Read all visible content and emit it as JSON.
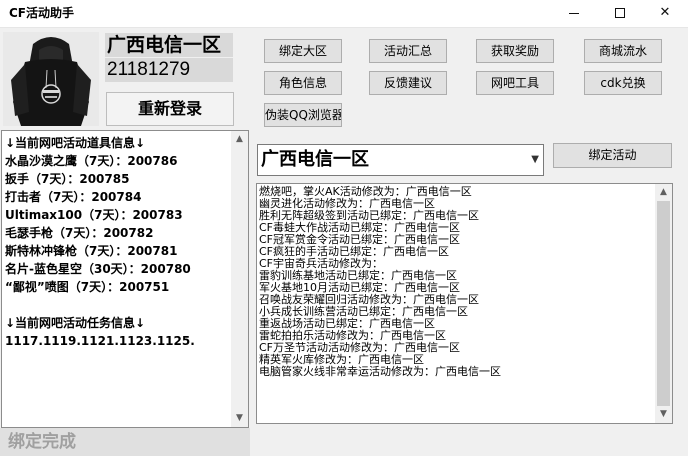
{
  "window": {
    "title": "CF活动助手",
    "controls": {
      "minimize": "—",
      "maximize": "☐",
      "close": "✕"
    }
  },
  "account": {
    "region": "广西电信一区",
    "id": "21181279",
    "relogin_label": "重新登录"
  },
  "toolbar": {
    "row1": [
      "绑定大区",
      "活动汇总",
      "获取奖励",
      "商城流水"
    ],
    "row2": [
      "角色信息",
      "反馈建议",
      "网吧工具",
      "cdk兑换"
    ],
    "row3": [
      "伪装QQ浏览器"
    ]
  },
  "info_panel": {
    "lines": [
      "↓当前网吧活动道具信息↓",
      "水晶沙漠之鹰（7天）：200786",
      "扳手（7天）：200785",
      "打击者（7天）：200784",
      "Ultimax100（7天）：200783",
      "毛瑟手枪（7天）：200782",
      "斯特林冲锋枪（7天）：200781",
      "名片-蓝色星空（30天）：200780",
      "“鄙视”喷图（7天）：200751",
      "",
      "↓当前网吧活动任务信息↓",
      "1117.1119.1121.1123.1125."
    ]
  },
  "status": {
    "text": "绑定完成"
  },
  "region_select": {
    "value": "广西电信一区"
  },
  "bind_activity_label": "绑定活动",
  "log": {
    "lines": [
      "燃烧吧，掌火AK活动修改为：广西电信一区",
      "幽灵进化活动修改为：广西电信一区",
      "胜利无阵超级签到活动已绑定：广西电信一区",
      "CF毒蛙大作战活动已绑定：广西电信一区",
      "CF冠军赏金令活动已绑定：广西电信一区",
      "CF疯狂的手活动已绑定：广西电信一区",
      "CF宇宙奇兵活动修改为：",
      "雷豹训练基地活动已绑定：广西电信一区",
      "军火基地10月活动已绑定：广西电信一区",
      "召唤战友荣耀回归活动修改为：广西电信一区",
      "小兵成长训练营活动已绑定：广西电信一区",
      "重返战场活动已绑定：广西电信一区",
      "雷蛇拍拍乐活动修改为：广西电信一区",
      "CF万圣节活动活动修改为：广西电信一区",
      "精英军火库修改为：广西电信一区",
      "电脑管家火线非常幸运活动修改为：广西电信一区"
    ]
  }
}
